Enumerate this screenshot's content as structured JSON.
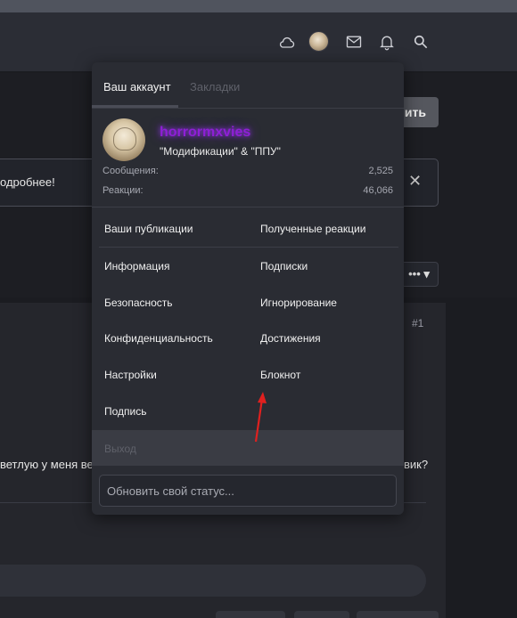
{
  "header": {
    "icons": [
      {
        "name": "cloud-icon"
      },
      {
        "name": "mail-icon"
      },
      {
        "name": "bell-icon"
      },
      {
        "name": "search-icon"
      }
    ]
  },
  "background": {
    "button_fragment": "ить",
    "notice_fragment": "одробнее!",
    "notice_close": "✕",
    "options_label": "••• ▾",
    "post_number": "#1",
    "post_text_left": "ветлую у меня вес",
    "post_text_right": "вик?"
  },
  "menu": {
    "tabs": [
      {
        "label": "Ваш аккаунт",
        "active": true
      },
      {
        "label": "Закладки",
        "active": false
      }
    ],
    "profile": {
      "username": "horrormxvies",
      "user_title": "\"Модификации\" & \"ППУ\"",
      "stats": [
        {
          "label": "Сообщения:",
          "value": "2,525"
        },
        {
          "label": "Реакции:",
          "value": "46,066"
        }
      ]
    },
    "links_row_top": {
      "left": "Ваши публикации",
      "right": "Полученные реакции"
    },
    "links": [
      {
        "left": "Информация",
        "right": "Подписки"
      },
      {
        "left": "Безопасность",
        "right": "Игнорирование"
      },
      {
        "left": "Конфиденциальность",
        "right": "Достижения"
      },
      {
        "left": "Настройки",
        "right": "Блокнот"
      },
      {
        "left": "Подпись",
        "right": ""
      }
    ],
    "logout": "Выход",
    "status_placeholder": "Обновить свой статус..."
  },
  "colors": {
    "username": "#8f1fd6",
    "annotation_arrow": "#e0201f",
    "menu_bg": "#2a2c33"
  }
}
